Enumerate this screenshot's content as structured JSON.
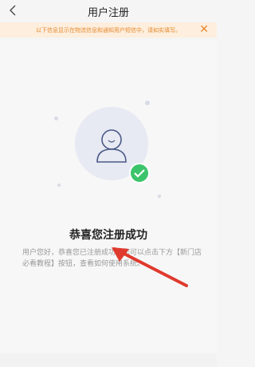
{
  "header": {
    "title": "用户注册",
    "back_icon": "chevron-left-icon"
  },
  "notice": {
    "text": "以下信息显示在物流信息和通知用户短信中，请如实填写。",
    "close_icon": "close-icon"
  },
  "success": {
    "title": "恭喜您注册成功",
    "description": "用户您好，恭喜您已注册成功，您可以点击下方【新门店必看教程】按钮，查看如何使用系统。"
  },
  "colors": {
    "accent": "#e58a2f",
    "notice_bg": "#fdeedd",
    "check_green": "#3cc46b",
    "arrow_red": "#e03a2e"
  }
}
